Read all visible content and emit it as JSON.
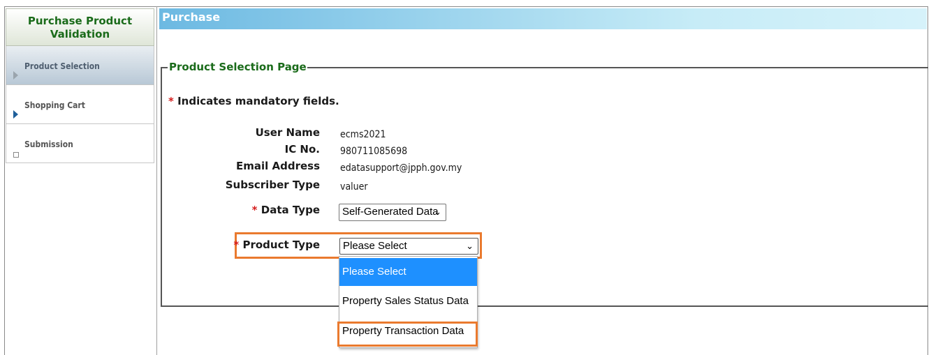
{
  "sidebar": {
    "title": "Purchase Product Validation",
    "items": [
      {
        "label": "Product Selection"
      },
      {
        "label": "Shopping Cart"
      },
      {
        "label": "Submission"
      }
    ]
  },
  "header": {
    "title": "Purchase"
  },
  "form": {
    "legend": "Product Selection Page",
    "mandatory_note": "Indicates mandatory fields.",
    "required_mark": "*",
    "fields": {
      "user_name": {
        "label": "User Name",
        "value": "ecms2021"
      },
      "ic_no": {
        "label": "IC No.",
        "value": "980711085698"
      },
      "email": {
        "label": "Email Address",
        "value": "edatasupport@jpph.gov.my"
      },
      "subscriber_type": {
        "label": "Subscriber Type",
        "value": "valuer"
      },
      "data_type": {
        "label": "Data Type",
        "selected": "Self-Generated Data"
      },
      "product_type": {
        "label": "Product Type",
        "selected": "Please Select",
        "options": [
          "Please Select",
          "Property Sales Status Data",
          "Property Transaction Data"
        ]
      }
    }
  },
  "colors": {
    "header_gradient_start": "#6cb9e2",
    "title_green": "#1a6b1a",
    "required_red": "#d41c1c",
    "highlight_orange": "#ea7a2e",
    "option_selected_blue": "#1e90ff"
  },
  "icons": {
    "chevron": "chevron-down-icon",
    "step_active": "triangle-right-icon",
    "step_pending": "square-icon"
  }
}
